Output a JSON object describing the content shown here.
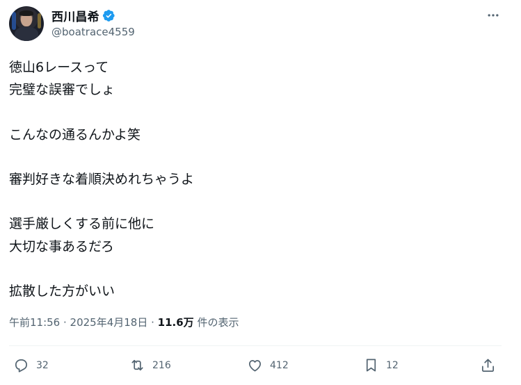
{
  "author": {
    "display_name": "西川昌希",
    "handle": "@boatrace4559",
    "verified": true
  },
  "tweet": {
    "lines": [
      "徳山6レースって",
      "完璧な誤審でしょ",
      "",
      "こんなの通るんかよ笑",
      "",
      "審判好きな着順決めれちゃうよ",
      "",
      "選手厳しくする前に他に",
      "大切な事あるだろ",
      "",
      "拡散した方がいい"
    ]
  },
  "meta": {
    "time": "午前11:56",
    "sep1": " · ",
    "date": "2025年4月18日",
    "sep2": " · ",
    "views_count": "11.6万",
    "views_label": " 件の表示"
  },
  "actions": {
    "reply_count": "32",
    "retweet_count": "216",
    "like_count": "412",
    "bookmark_count": "12"
  },
  "colors": {
    "verified": "#1d9bf0",
    "secondary_text": "#536471",
    "text": "#0f1419"
  },
  "icons": [
    "verified-badge-icon",
    "more-icon",
    "reply-icon",
    "retweet-icon",
    "like-icon",
    "bookmark-icon",
    "share-icon"
  ]
}
